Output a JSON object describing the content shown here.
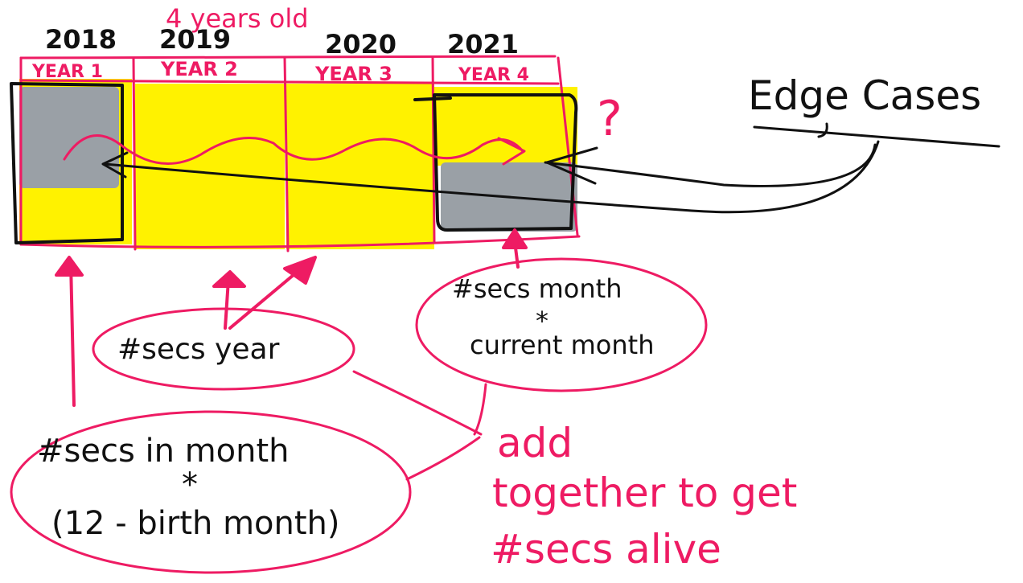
{
  "header": {
    "age_note": "4 years old",
    "years": [
      "2018",
      "2019",
      "2020",
      "2021"
    ],
    "year_labels": [
      "YEAR 1",
      "YEAR 2",
      "YEAR 3",
      "YEAR 4"
    ]
  },
  "notes": {
    "question_mark": "?",
    "edge_cases": "Edge Cases"
  },
  "bubbles": {
    "secs_year": "#secs year",
    "secs_month_line1": "#secs month",
    "secs_month_star": "*",
    "secs_month_line2": "current month",
    "secs_in_month_line1": "#secs in month",
    "secs_in_month_star": "*",
    "secs_in_month_line2": "(12 - birth month)"
  },
  "summary": {
    "line1": "add",
    "line2": "together to get",
    "line3": "#secs alive"
  },
  "colors": {
    "pink": "#ee1b63",
    "black": "#111111",
    "yellow": "#fff200",
    "gray": "#9aa0a6"
  }
}
